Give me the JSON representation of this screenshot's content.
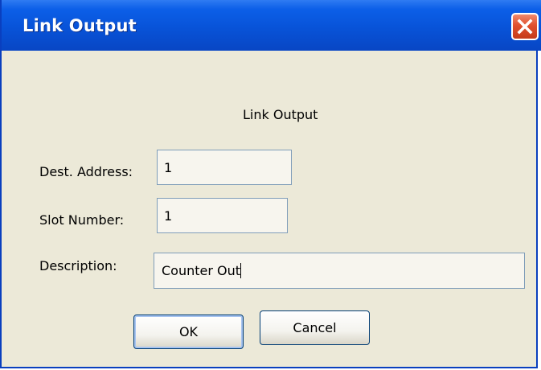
{
  "window": {
    "title": "Link Output"
  },
  "form": {
    "heading": "Link Output",
    "dest_address_label": "Dest. Address:",
    "dest_address_value": "1",
    "slot_number_label": "Slot Number:",
    "slot_number_value": "1",
    "description_label": "Description:",
    "description_value": "Counter Out"
  },
  "buttons": {
    "ok_label": "OK",
    "cancel_label": "Cancel"
  },
  "icons": {
    "close": "close-icon"
  },
  "colors": {
    "titlebar": "#0853d8",
    "dialog_bg": "#ece9d8",
    "close_button": "#e0502e"
  }
}
